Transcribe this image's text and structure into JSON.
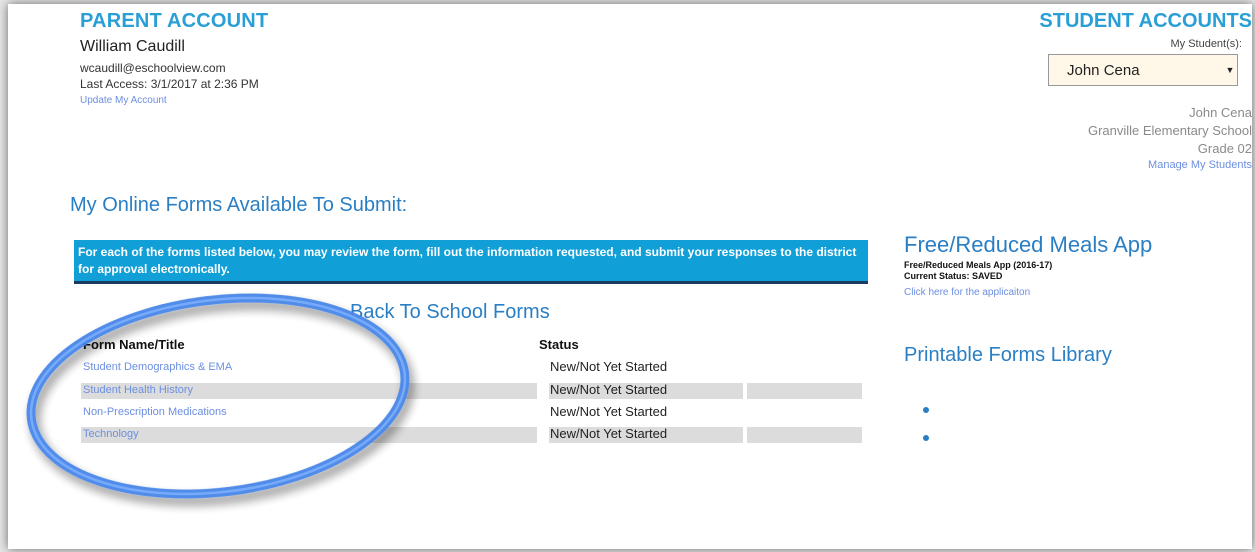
{
  "parent": {
    "title": "PARENT ACCOUNT",
    "name": "William Caudill",
    "email": "wcaudill@eschoolview.com",
    "last_access": "Last Access: 3/1/2017 at 2:36 PM",
    "update_link": "Update My Account"
  },
  "student": {
    "title": "STUDENT ACCOUNTS",
    "select_label": "My Student(s):",
    "selected": "John Cena",
    "name": "John Cena",
    "school": "Granville Elementary School",
    "grade": "Grade 02",
    "manage_link": "Manage My Students"
  },
  "forms": {
    "heading": "My Online Forms Available To Submit:",
    "info_text": "For each of the forms listed below, you may review the form, fill out the information requested, and submit your responses to the district for approval electronically.",
    "section_title": "Back To School Forms",
    "col_name": "Form Name/Title",
    "col_status": "Status",
    "rows": [
      {
        "name": "Student Demographics & EMA",
        "status": "New/Not Yet Started"
      },
      {
        "name": "Student Health History",
        "status": "New/Not Yet Started"
      },
      {
        "name": "Non-Prescription Medications",
        "status": "New/Not Yet Started"
      },
      {
        "name": "Technology",
        "status": "New/Not Yet Started"
      }
    ]
  },
  "meals": {
    "title": "Free/Reduced Meals App",
    "app_name": "Free/Reduced Meals App (2016-17)",
    "status": "Current Status: SAVED",
    "link": "Click here for the applicaiton"
  },
  "library": {
    "title": "Printable Forms Library"
  },
  "colors": {
    "accent": "#2a9fd6",
    "info_bar": "#119fd8",
    "link": "#6c8fe0",
    "highlight_ring": "#4a86e8"
  }
}
